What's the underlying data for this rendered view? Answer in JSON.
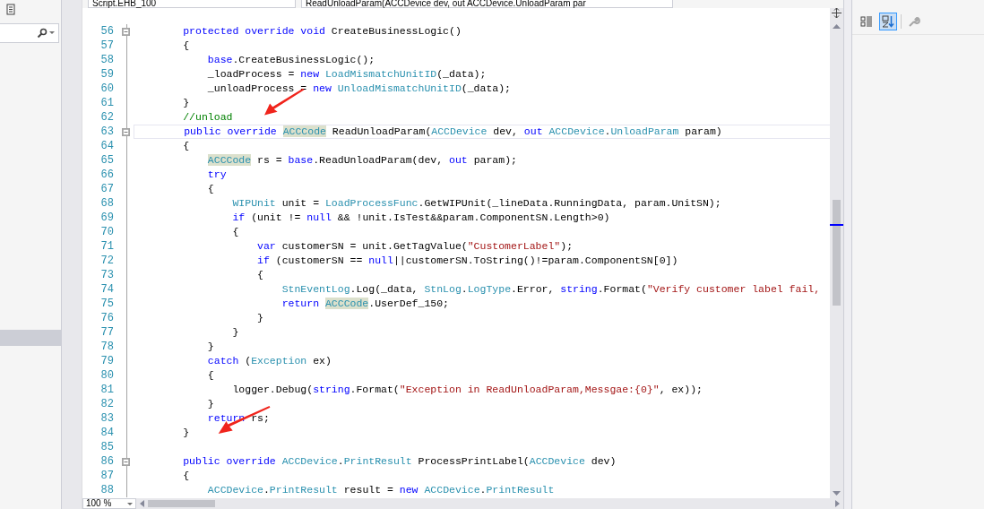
{
  "editor": {
    "file_combo": "Script.EHB_100",
    "member_combo": "ReadUnloadParam(ACCDevice dev, out ACCDevice.UnloadParam par",
    "zoom": "100 %",
    "lines": [
      {
        "number": "56",
        "collapsible": true,
        "current": false,
        "tokens": [
          {
            "kind": "kw",
            "t": "        protected override void"
          },
          {
            "kind": "plain",
            "t": " CreateBusinessLogic()"
          }
        ]
      },
      {
        "number": "57",
        "collapsible": false,
        "current": false,
        "tokens": [
          {
            "kind": "plain",
            "t": "        {"
          }
        ]
      },
      {
        "number": "58",
        "collapsible": false,
        "current": false,
        "tokens": [
          {
            "kind": "kw",
            "t": "            base"
          },
          {
            "kind": "plain",
            "t": ".CreateBusinessLogic();"
          }
        ]
      },
      {
        "number": "59",
        "collapsible": false,
        "current": false,
        "tokens": [
          {
            "kind": "plain",
            "t": "            _loadProcess = "
          },
          {
            "kind": "kw",
            "t": "new "
          },
          {
            "kind": "type",
            "t": "LoadMismatchUnitID"
          },
          {
            "kind": "plain",
            "t": "(_data);"
          }
        ]
      },
      {
        "number": "60",
        "collapsible": false,
        "current": false,
        "tokens": [
          {
            "kind": "plain",
            "t": "            _unloadProcess = "
          },
          {
            "kind": "kw",
            "t": "new "
          },
          {
            "kind": "type",
            "t": "UnloadMismatchUnitID"
          },
          {
            "kind": "plain",
            "t": "(_data);"
          }
        ]
      },
      {
        "number": "61",
        "collapsible": false,
        "current": false,
        "tokens": [
          {
            "kind": "plain",
            "t": "        }"
          }
        ]
      },
      {
        "number": "62",
        "collapsible": false,
        "current": false,
        "tokens": [
          {
            "kind": "comment",
            "t": "        //unload"
          }
        ]
      },
      {
        "number": "63",
        "collapsible": true,
        "current": true,
        "tokens": [
          {
            "kind": "kw",
            "t": "        public override "
          },
          {
            "kind": "ref",
            "t": "ACCCode"
          },
          {
            "kind": "plain",
            "t": " ReadUnloadParam("
          },
          {
            "kind": "type",
            "t": "ACCDevice"
          },
          {
            "kind": "plain",
            "t": " dev, "
          },
          {
            "kind": "kw",
            "t": "out "
          },
          {
            "kind": "type",
            "t": "ACCDevice"
          },
          {
            "kind": "plain",
            "t": "."
          },
          {
            "kind": "type",
            "t": "UnloadParam"
          },
          {
            "kind": "plain",
            "t": " param)"
          }
        ]
      },
      {
        "number": "64",
        "collapsible": false,
        "current": false,
        "tokens": [
          {
            "kind": "plain",
            "t": "        {"
          }
        ]
      },
      {
        "number": "65",
        "collapsible": false,
        "current": false,
        "tokens": [
          {
            "kind": "ref",
            "t": "            ACCCode"
          },
          {
            "kind": "plain",
            "t": " rs = "
          },
          {
            "kind": "kw",
            "t": "base"
          },
          {
            "kind": "plain",
            "t": ".ReadUnloadParam(dev, "
          },
          {
            "kind": "kw",
            "t": "out"
          },
          {
            "kind": "plain",
            "t": " param);"
          }
        ]
      },
      {
        "number": "66",
        "collapsible": false,
        "current": false,
        "tokens": [
          {
            "kind": "kw",
            "t": "            try"
          }
        ]
      },
      {
        "number": "67",
        "collapsible": false,
        "current": false,
        "tokens": [
          {
            "kind": "plain",
            "t": "            {"
          }
        ]
      },
      {
        "number": "68",
        "collapsible": false,
        "current": false,
        "tokens": [
          {
            "kind": "type",
            "t": "                WIPUnit"
          },
          {
            "kind": "plain",
            "t": " unit = "
          },
          {
            "kind": "type",
            "t": "LoadProcessFunc"
          },
          {
            "kind": "plain",
            "t": ".GetWIPUnit(_lineData.RunningData, param.UnitSN);"
          }
        ]
      },
      {
        "number": "69",
        "collapsible": false,
        "current": false,
        "tokens": [
          {
            "kind": "kw",
            "t": "                if"
          },
          {
            "kind": "plain",
            "t": " (unit != "
          },
          {
            "kind": "kw",
            "t": "null"
          },
          {
            "kind": "plain",
            "t": " && !unit.IsTest&&param.ComponentSN.Length>0)"
          }
        ]
      },
      {
        "number": "70",
        "collapsible": false,
        "current": false,
        "tokens": [
          {
            "kind": "plain",
            "t": "                {"
          }
        ]
      },
      {
        "number": "71",
        "collapsible": false,
        "current": false,
        "tokens": [
          {
            "kind": "kw",
            "t": "                    var"
          },
          {
            "kind": "plain",
            "t": " customerSN = unit.GetTagValue("
          },
          {
            "kind": "str",
            "t": "\"CustomerLabel\""
          },
          {
            "kind": "plain",
            "t": ");"
          }
        ]
      },
      {
        "number": "72",
        "collapsible": false,
        "current": false,
        "tokens": [
          {
            "kind": "kw",
            "t": "                    if"
          },
          {
            "kind": "plain",
            "t": " (customerSN == "
          },
          {
            "kind": "kw",
            "t": "null"
          },
          {
            "kind": "plain",
            "t": "||customerSN.ToString()!=param.ComponentSN[0])"
          }
        ]
      },
      {
        "number": "73",
        "collapsible": false,
        "current": false,
        "tokens": [
          {
            "kind": "plain",
            "t": "                    {"
          }
        ]
      },
      {
        "number": "74",
        "collapsible": false,
        "current": false,
        "tokens": [
          {
            "kind": "type",
            "t": "                        StnEventLog"
          },
          {
            "kind": "plain",
            "t": ".Log(_data, "
          },
          {
            "kind": "type",
            "t": "StnLog"
          },
          {
            "kind": "plain",
            "t": "."
          },
          {
            "kind": "type",
            "t": "LogType"
          },
          {
            "kind": "plain",
            "t": ".Error, "
          },
          {
            "kind": "kw",
            "t": "string"
          },
          {
            "kind": "plain",
            "t": ".Format("
          },
          {
            "kind": "str",
            "t": "\"Verify customer label fail,"
          }
        ]
      },
      {
        "number": "75",
        "collapsible": false,
        "current": false,
        "tokens": [
          {
            "kind": "kw",
            "t": "                        return "
          },
          {
            "kind": "ref",
            "t": "ACCCode"
          },
          {
            "kind": "plain",
            "t": ".UserDef_150;"
          }
        ]
      },
      {
        "number": "76",
        "collapsible": false,
        "current": false,
        "tokens": [
          {
            "kind": "plain",
            "t": "                    }"
          }
        ]
      },
      {
        "number": "77",
        "collapsible": false,
        "current": false,
        "tokens": [
          {
            "kind": "plain",
            "t": "                }"
          }
        ]
      },
      {
        "number": "78",
        "collapsible": false,
        "current": false,
        "tokens": [
          {
            "kind": "plain",
            "t": "            }"
          }
        ]
      },
      {
        "number": "79",
        "collapsible": false,
        "current": false,
        "tokens": [
          {
            "kind": "kw",
            "t": "            catch"
          },
          {
            "kind": "plain",
            "t": " ("
          },
          {
            "kind": "type",
            "t": "Exception"
          },
          {
            "kind": "plain",
            "t": " ex)"
          }
        ]
      },
      {
        "number": "80",
        "collapsible": false,
        "current": false,
        "tokens": [
          {
            "kind": "plain",
            "t": "            {"
          }
        ]
      },
      {
        "number": "81",
        "collapsible": false,
        "current": false,
        "tokens": [
          {
            "kind": "plain",
            "t": "                logger.Debug("
          },
          {
            "kind": "kw",
            "t": "string"
          },
          {
            "kind": "plain",
            "t": ".Format("
          },
          {
            "kind": "str",
            "t": "\"Exception in ReadUnloadParam,Messgae:{0}\""
          },
          {
            "kind": "plain",
            "t": ", ex));"
          }
        ]
      },
      {
        "number": "82",
        "collapsible": false,
        "current": false,
        "tokens": [
          {
            "kind": "plain",
            "t": "            }"
          }
        ]
      },
      {
        "number": "83",
        "collapsible": false,
        "current": false,
        "tokens": [
          {
            "kind": "kw",
            "t": "            return"
          },
          {
            "kind": "plain",
            "t": " rs;"
          }
        ]
      },
      {
        "number": "84",
        "collapsible": false,
        "current": false,
        "tokens": [
          {
            "kind": "plain",
            "t": "        }"
          }
        ]
      },
      {
        "number": "85",
        "collapsible": false,
        "current": false
      },
      {
        "number": "86",
        "collapsible": true,
        "current": false,
        "tokens": [
          {
            "kind": "kw",
            "t": "        public override "
          },
          {
            "kind": "type",
            "t": "ACCDevice"
          },
          {
            "kind": "plain",
            "t": "."
          },
          {
            "kind": "type",
            "t": "PrintResult"
          },
          {
            "kind": "plain",
            "t": " ProcessPrintLabel("
          },
          {
            "kind": "type",
            "t": "ACCDevice"
          },
          {
            "kind": "plain",
            "t": " dev)"
          }
        ]
      },
      {
        "number": "87",
        "collapsible": false,
        "current": false,
        "tokens": [
          {
            "kind": "plain",
            "t": "        {"
          }
        ]
      },
      {
        "number": "88",
        "collapsible": false,
        "current": false,
        "tokens": [
          {
            "kind": "type",
            "t": "            ACCDevice"
          },
          {
            "kind": "plain",
            "t": "."
          },
          {
            "kind": "type",
            "t": "PrintResult"
          },
          {
            "kind": "plain",
            "t": " result = "
          },
          {
            "kind": "kw",
            "t": "new "
          },
          {
            "kind": "type",
            "t": "ACCDevice"
          },
          {
            "kind": "plain",
            "t": "."
          },
          {
            "kind": "type",
            "t": "PrintResult"
          }
        ]
      }
    ]
  }
}
